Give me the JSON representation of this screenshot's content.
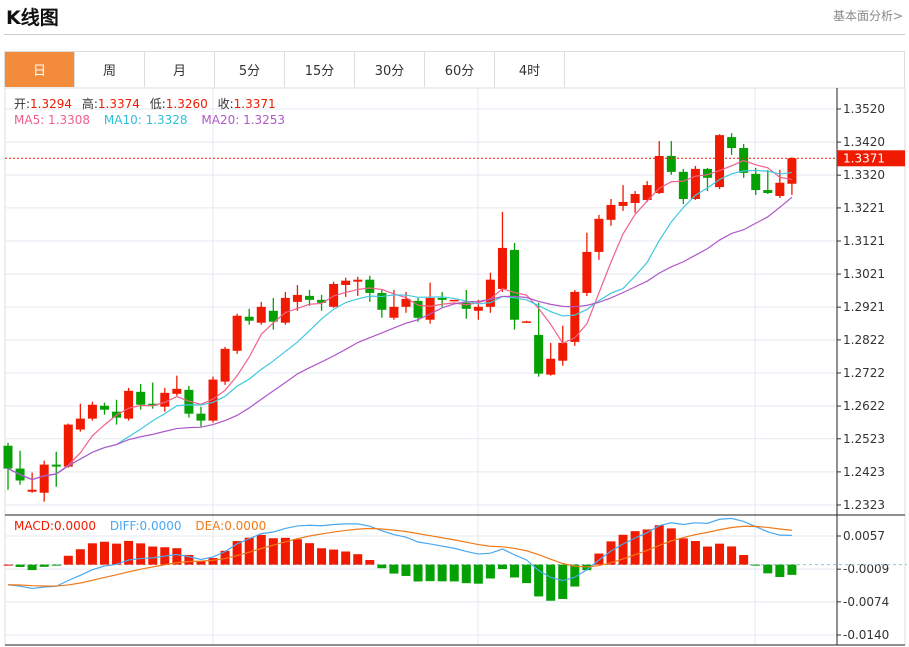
{
  "header": {
    "title": "K线图",
    "link": "基本面分析>"
  },
  "tabs": [
    "日",
    "周",
    "月",
    "5分",
    "15分",
    "30分",
    "60分",
    "4时"
  ],
  "active_tab": 0,
  "ohlc_legend": {
    "open_label": "开:",
    "open": "1.3294",
    "high_label": "高:",
    "high": "1.3374",
    "low_label": "低:",
    "low": "1.3260",
    "close_label": "收:",
    "close": "1.3371"
  },
  "ma_legend": {
    "ma5": "MA5: 1.3308",
    "ma10": "MA10: 1.3328",
    "ma20": "MA20: 1.3253"
  },
  "macd_legend": {
    "macd": "MACD:0.0000",
    "diff": "DIFF:0.0000",
    "dea": "DEA:0.0000"
  },
  "current_price": "1.3371",
  "colors": {
    "up": "#f01a00",
    "down": "#04a004",
    "ma5": "#f0608a",
    "ma10": "#40c8e0",
    "ma20": "#b058c8",
    "diff": "#4aa8f0",
    "dea": "#f07a1a",
    "accent": "#f28c3c"
  },
  "chart_data": {
    "type": "candlestick",
    "title": "K线图",
    "price_ticks": [
      "1.3520",
      "1.3420",
      "1.3320",
      "1.3221",
      "1.3121",
      "1.3021",
      "1.2921",
      "1.2822",
      "1.2722",
      "1.2622",
      "1.2523",
      "1.2423",
      "1.2323"
    ],
    "price_range": [
      1.2323,
      1.352
    ],
    "macd_ticks": [
      "0.0057",
      "-0.0009",
      "-0.0074",
      "-0.0140"
    ],
    "macd_range": [
      -0.014,
      0.0057
    ],
    "candles": [
      [
        1.2502,
        1.2433,
        1.2511,
        1.2369
      ],
      [
        1.2433,
        1.2397,
        1.2487,
        1.2384
      ],
      [
        1.2363,
        1.2369,
        1.2421,
        1.236
      ],
      [
        1.236,
        1.2445,
        1.2457,
        1.2333
      ],
      [
        1.2445,
        1.2439,
        1.2484,
        1.2378
      ],
      [
        1.2439,
        1.2566,
        1.2569,
        1.2436
      ],
      [
        1.2551,
        1.2584,
        1.2629,
        1.2545
      ],
      [
        1.2584,
        1.2626,
        1.2635,
        1.2578
      ],
      [
        1.2623,
        1.2611,
        1.2632,
        1.2596
      ],
      [
        1.2605,
        1.2587,
        1.2641,
        1.2566
      ],
      [
        1.2584,
        1.2668,
        1.2677,
        1.2578
      ],
      [
        1.2665,
        1.2626,
        1.2689,
        1.2611
      ],
      [
        1.2629,
        1.2623,
        1.2693,
        1.2614
      ],
      [
        1.262,
        1.2662,
        1.2677,
        1.2605
      ],
      [
        1.2659,
        1.2674,
        1.2714,
        1.2653
      ],
      [
        1.2671,
        1.2599,
        1.2683,
        1.2587
      ],
      [
        1.2599,
        1.2578,
        1.262,
        1.256
      ],
      [
        1.2578,
        1.2702,
        1.2711,
        1.2572
      ],
      [
        1.2696,
        1.2795,
        1.2801,
        1.2686
      ],
      [
        1.2789,
        1.2895,
        1.2901,
        1.278
      ],
      [
        1.2892,
        1.288,
        1.2916,
        1.2868
      ],
      [
        1.2874,
        1.2922,
        1.2937,
        1.2868
      ],
      [
        1.291,
        1.2877,
        1.2949,
        1.2853
      ],
      [
        1.2874,
        1.2949,
        1.2967,
        1.2868
      ],
      [
        1.2937,
        1.2958,
        1.2988,
        1.291
      ],
      [
        1.2955,
        1.2943,
        1.2973,
        1.2925
      ],
      [
        1.2943,
        1.2934,
        1.2958,
        1.291
      ],
      [
        1.2922,
        1.2991,
        1.2998,
        1.2919
      ],
      [
        1.2988,
        1.3001,
        1.301,
        1.2952
      ],
      [
        1.2998,
        1.3004,
        1.3013,
        1.2955
      ],
      [
        1.3004,
        1.2964,
        1.3016,
        1.2937
      ],
      [
        1.2964,
        1.2913,
        1.2973,
        1.2889
      ],
      [
        1.2889,
        1.2922,
        1.2973,
        1.2883
      ],
      [
        1.2922,
        1.2946,
        1.2967,
        1.2904
      ],
      [
        1.294,
        1.2889,
        1.2949,
        1.2877
      ],
      [
        1.2883,
        1.2949,
        1.2995,
        1.2871
      ],
      [
        1.2949,
        1.2943,
        1.2967,
        1.2922
      ],
      [
        1.294,
        1.2943,
        1.2943,
        1.294
      ],
      [
        1.2934,
        1.2916,
        1.2973,
        1.2886
      ],
      [
        1.291,
        1.2922,
        1.2943,
        1.2883
      ],
      [
        1.2922,
        1.3004,
        1.3025,
        1.2904
      ],
      [
        1.2976,
        1.31,
        1.3209,
        1.2967
      ],
      [
        1.3094,
        1.2883,
        1.3115,
        1.2853
      ],
      [
        1.2877,
        1.2878,
        1.288,
        1.2877
      ],
      [
        1.2837,
        1.272,
        1.2934,
        1.2711
      ],
      [
        1.2717,
        1.2765,
        1.2813,
        1.2714
      ],
      [
        1.2759,
        1.2813,
        1.2865,
        1.2744
      ],
      [
        1.2816,
        1.2967,
        1.2973,
        1.2804
      ],
      [
        1.2964,
        1.3088,
        1.3146,
        1.2955
      ],
      [
        1.3088,
        1.3188,
        1.32,
        1.3064
      ],
      [
        1.3185,
        1.323,
        1.3248,
        1.3167
      ],
      [
        1.3227,
        1.3239,
        1.329,
        1.3212
      ],
      [
        1.3236,
        1.3263,
        1.3272,
        1.3206
      ],
      [
        1.3245,
        1.329,
        1.3302,
        1.3239
      ],
      [
        1.3266,
        1.3378,
        1.3423,
        1.3263
      ],
      [
        1.3378,
        1.333,
        1.3423,
        1.3321
      ],
      [
        1.333,
        1.3248,
        1.3339,
        1.3233
      ],
      [
        1.3248,
        1.3339,
        1.3348,
        1.3245
      ],
      [
        1.3339,
        1.3312,
        1.3342,
        1.3272
      ],
      [
        1.3284,
        1.3441,
        1.3444,
        1.3278
      ],
      [
        1.3435,
        1.3402,
        1.3447,
        1.3381
      ],
      [
        1.3402,
        1.3327,
        1.3414,
        1.3312
      ],
      [
        1.3324,
        1.3275,
        1.3342,
        1.326
      ],
      [
        1.3275,
        1.3266,
        1.3336,
        1.3263
      ],
      [
        1.3257,
        1.3297,
        1.3336,
        1.3251
      ],
      [
        1.3294,
        1.3371,
        1.3374,
        1.326
      ]
    ]
  }
}
